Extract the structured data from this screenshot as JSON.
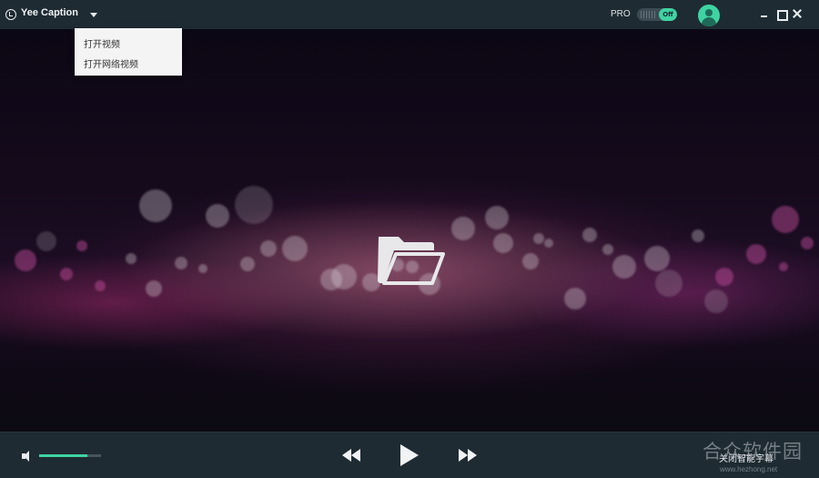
{
  "app": {
    "title": "Yee Caption",
    "logo_icon": "clock-check-icon",
    "dropdown_icon": "caret-down-icon"
  },
  "header": {
    "pro_label": "PRO",
    "pro_toggle_label": "Off",
    "avatar_icon": "user-avatar-icon",
    "window_controls": [
      "minimize-icon",
      "maximize-icon",
      "close-icon"
    ]
  },
  "menu": {
    "items": [
      {
        "label": "打开视频"
      },
      {
        "label": "打开网络视频"
      }
    ]
  },
  "player": {
    "center_icon": "open-folder-icon",
    "volume_fraction": 0.78,
    "rewind_icon": "rewind-icon",
    "play_icon": "play-icon",
    "forward_icon": "fast-forward-icon",
    "subtitle_toggle_label": "关闭智能字幕"
  },
  "watermark": {
    "title": "合众软件园",
    "url": "www.hezhong.net"
  },
  "colors": {
    "accent": "#3fd3a2",
    "titlebar": "#1e2b33",
    "menu_bg": "#f4f4f4"
  }
}
